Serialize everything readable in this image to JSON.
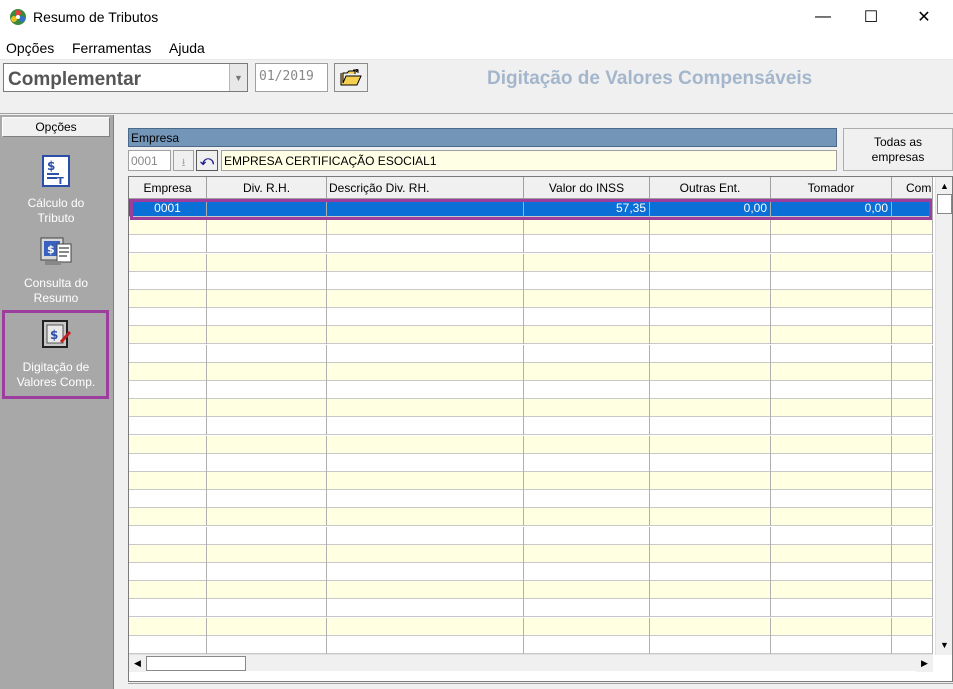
{
  "window": {
    "title": "Resumo de Tributos",
    "controls": {
      "minimize": "—",
      "maximize": "☐",
      "close": "✕"
    }
  },
  "menu": [
    "Opções",
    "Ferramentas",
    "Ajuda"
  ],
  "toolbar": {
    "type_value": "Complementar",
    "period_value": "01/2019",
    "screen_title": "Digitação de Valores Compensáveis"
  },
  "sidebar": {
    "header": "Opções",
    "items": [
      {
        "label_1": "Cálculo do",
        "label_2": "Tributo",
        "icon": "calculator-document-icon",
        "selected": false
      },
      {
        "label_1": "Consulta do",
        "label_2": "Resumo",
        "icon": "monitor-report-icon",
        "selected": false
      },
      {
        "label_1": "Digitação de",
        "label_2": "Valores Comp.",
        "icon": "money-edit-icon",
        "selected": true
      }
    ],
    "selection_color": "#9d3d9d"
  },
  "empresa": {
    "header": "Empresa",
    "code": "0001",
    "name": "EMPRESA CERTIFICAÇÃO ESOCIAL1",
    "all_button_1": "Todas as",
    "all_button_2": "empresas"
  },
  "grid": {
    "columns": [
      "Empresa",
      "Div. R.H.",
      "Descrição Div. RH.",
      "Valor do INSS",
      "Outras Ent.",
      "Tomador",
      "Com"
    ],
    "rows": [
      [
        "0001",
        "",
        "",
        "57,35",
        "0,00",
        "0,00",
        ""
      ]
    ],
    "selected_row_color": "#0a6fd6",
    "row_highlight_color": "#9d3d9d"
  }
}
